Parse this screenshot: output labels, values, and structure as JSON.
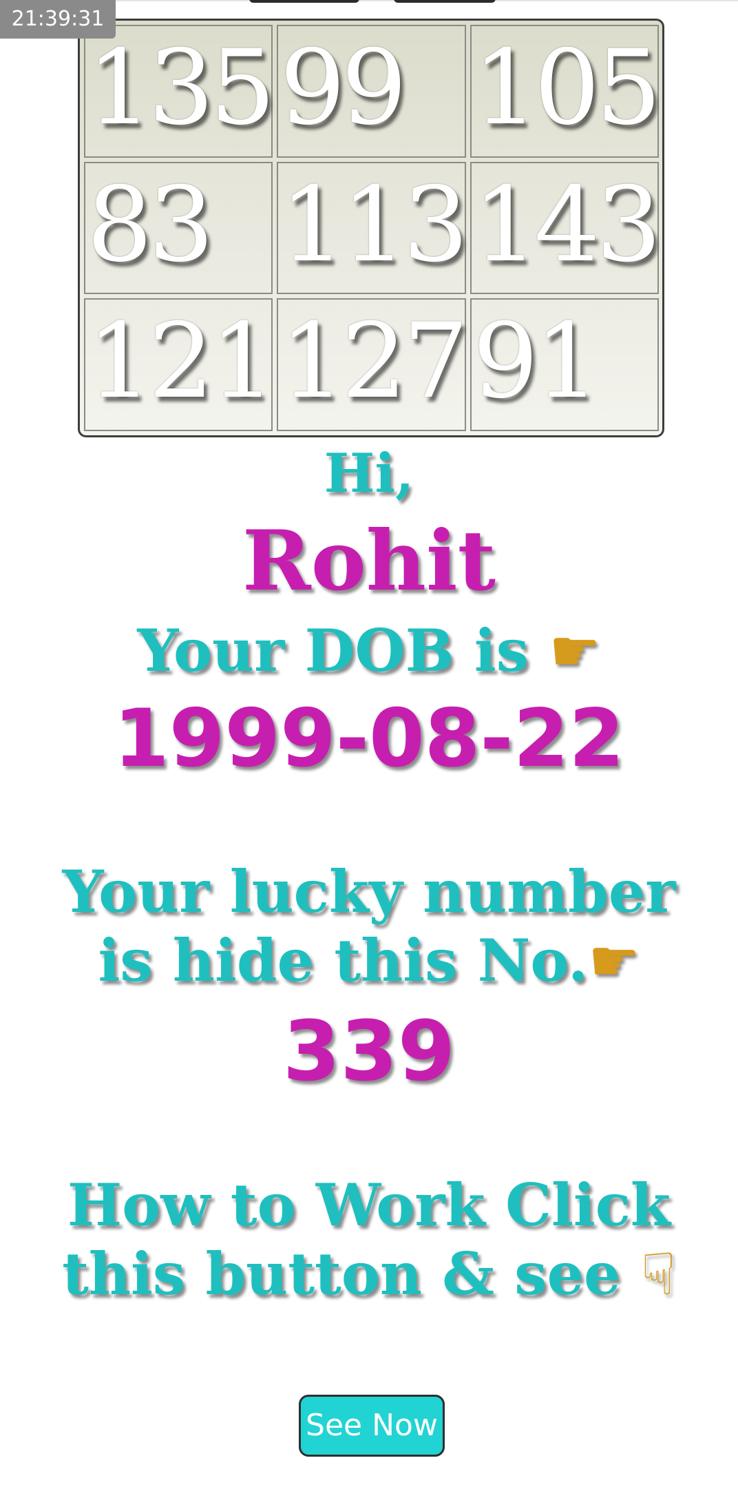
{
  "status_bar": {
    "time": "21:39:31"
  },
  "grid": {
    "rows": [
      [
        "135",
        "99",
        "105"
      ],
      [
        "83",
        "113",
        "143"
      ],
      [
        "121",
        "127",
        "91"
      ]
    ]
  },
  "greeting": {
    "hi": "Hi,",
    "name": "Rohit",
    "dob_label": "Your DOB is",
    "dob_pointer_icon": "pointing-right-hand-icon",
    "dob_value": "1999-08-22"
  },
  "lucky": {
    "line1": "Your lucky number",
    "line2": "is hide this No.",
    "pointer_icon": "pointing-right-hand-icon",
    "value": "339"
  },
  "how_to": {
    "line1": "How to Work Click",
    "line2": "this button & see",
    "pointer_icon": "pointing-down-hand-icon"
  },
  "button": {
    "label": "See Now"
  },
  "colors": {
    "teal": "#1fbfbf",
    "magenta": "#c61faf",
    "button_bg": "#22d3d3",
    "hand": "#d69a1c"
  }
}
